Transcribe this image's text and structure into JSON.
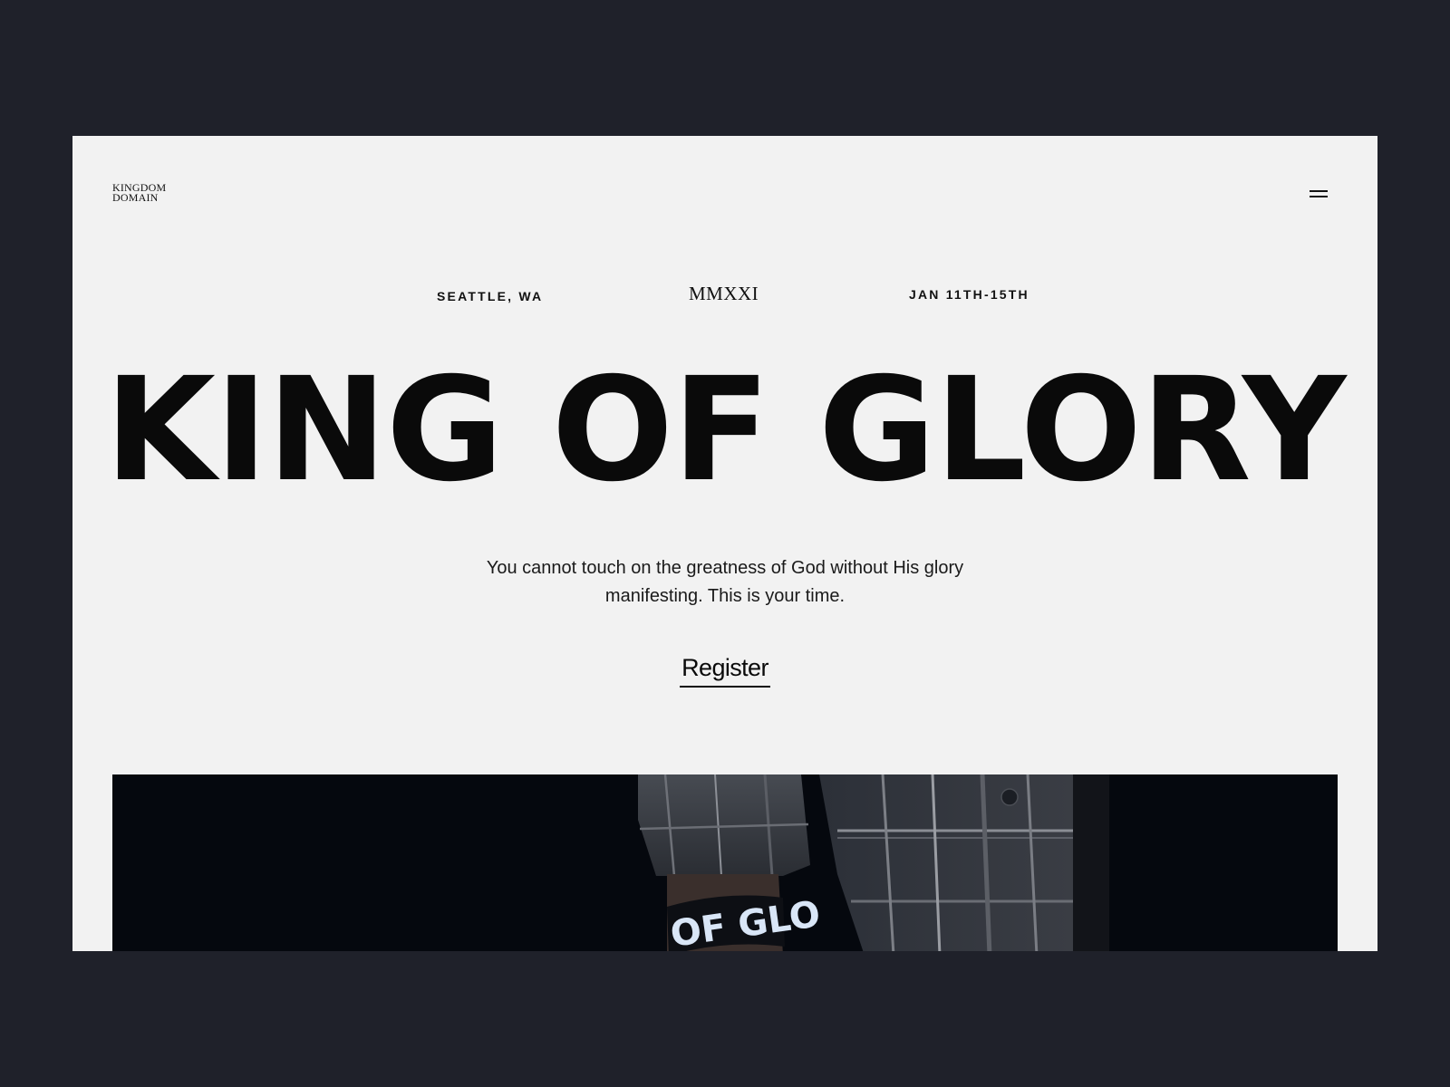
{
  "header": {
    "logo_line1": "KINGDOM",
    "logo_line2": "DOMAIN"
  },
  "event": {
    "location": "SEATTLE, WA",
    "year": "MMXXI",
    "dates": "JAN 11TH-15TH"
  },
  "hero": {
    "title": "KING OF GLORY",
    "subtitle": "You cannot touch on the greatness of God without His glory manifesting. This is your time.",
    "register_label": "Register",
    "image_wristband_text": "OF GLO"
  },
  "colors": {
    "outer_background": "#1f212a",
    "page_background": "#f2f2f2",
    "text": "#0a0a0a",
    "photo_background": "#05080e",
    "wristband_accent": "#3c7bd6"
  },
  "icons": {
    "menu": "hamburger-menu-icon"
  }
}
